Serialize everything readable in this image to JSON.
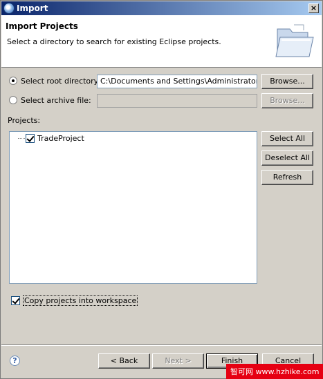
{
  "window": {
    "title": "Import",
    "close_glyph": "×"
  },
  "banner": {
    "title": "Import Projects",
    "description": "Select a directory to search for existing Eclipse projects.",
    "icon": "folder-icon"
  },
  "source": {
    "root_directory": {
      "label": "Select root directory:",
      "selected": true,
      "value": "C:\\Documents and Settings\\Administrator\\Des",
      "browse_label": "Browse..."
    },
    "archive_file": {
      "label": "Select archive file:",
      "selected": false,
      "value": "",
      "browse_label": "Browse..."
    }
  },
  "projects": {
    "label": "Projects:",
    "items": [
      {
        "name": "TradeProject",
        "checked": true
      }
    ],
    "select_all_label": "Select All",
    "deselect_all_label": "Deselect All",
    "refresh_label": "Refresh"
  },
  "options": {
    "copy_into_workspace": {
      "label": "Copy projects into workspace",
      "checked": true
    }
  },
  "footer": {
    "help_glyph": "?",
    "back_label": "< Back",
    "next_label": "Next >",
    "finish_label": "Finish",
    "cancel_label": "Cancel"
  },
  "watermark": {
    "text": "智可网 www.hzhike.com"
  }
}
